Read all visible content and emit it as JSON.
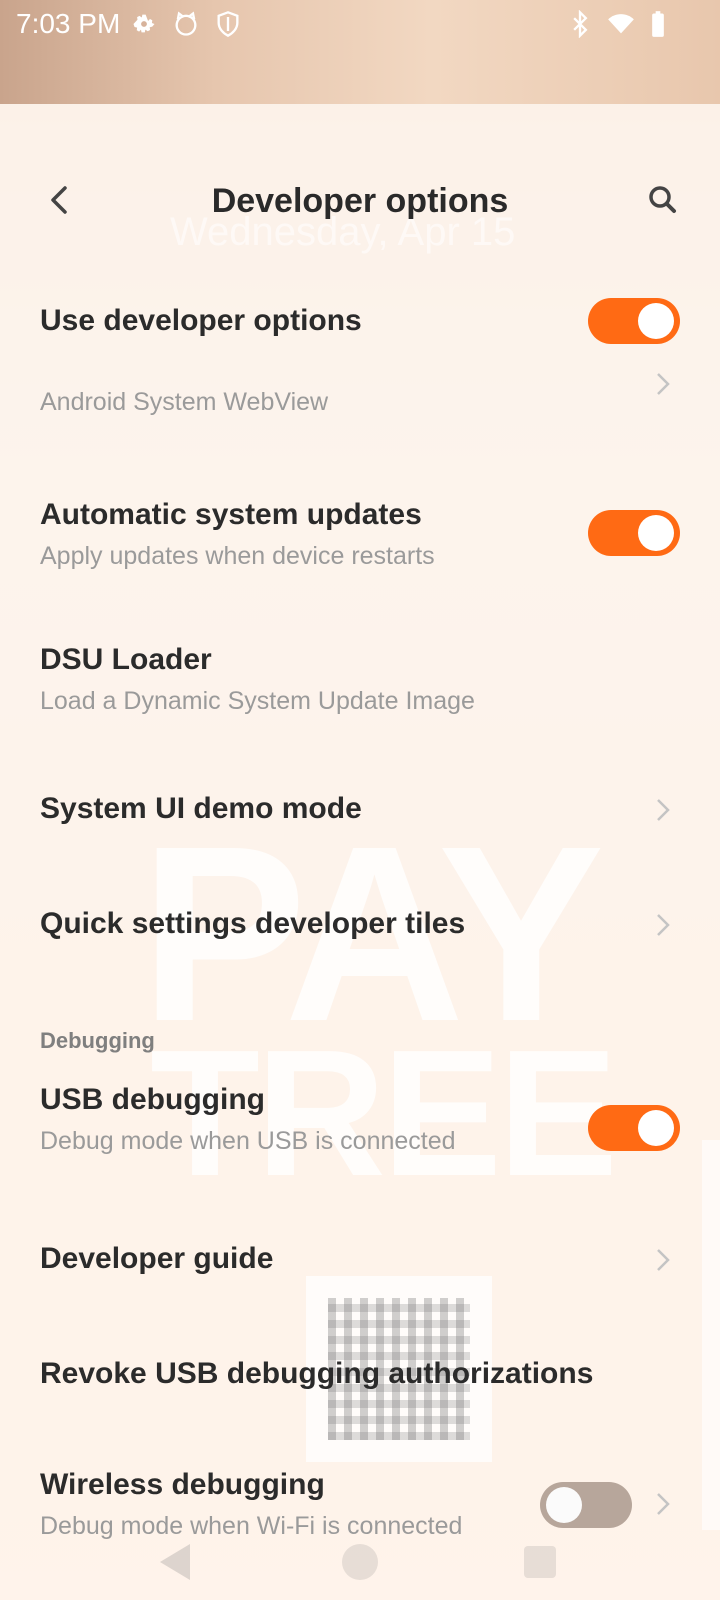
{
  "status_bar": {
    "time": "7:03 PM",
    "icons": [
      "gear-icon",
      "cat-face-icon",
      "shield-icon",
      "bluetooth-icon",
      "wifi-icon",
      "battery-icon"
    ]
  },
  "header": {
    "title": "Developer options",
    "back_icon": "chevron-left-icon",
    "search_icon": "search-icon"
  },
  "background": {
    "clock_text": "Wednesday, Apr 15",
    "wallpaper_line1": "PAY",
    "wallpaper_line2": "TREE"
  },
  "colors": {
    "accent": "#ff6a14",
    "toggle_off": "#b7a69b"
  },
  "settings": {
    "use_dev_options": {
      "title": "Use developer options",
      "enabled": true
    },
    "webview": {
      "subtitle": "Android System WebView"
    },
    "auto_updates": {
      "title": "Automatic system updates",
      "subtitle": "Apply updates when device restarts",
      "enabled": true
    },
    "dsu_loader": {
      "title": "DSU Loader",
      "subtitle": "Load a Dynamic System Update Image"
    },
    "demo_mode": {
      "title": "System UI demo mode"
    },
    "qs_tiles": {
      "title": "Quick settings developer tiles"
    },
    "debugging_header": "Debugging",
    "usb_debugging": {
      "title": "USB debugging",
      "subtitle": "Debug mode when USB is connected",
      "enabled": true
    },
    "developer_guide": {
      "title": "Developer guide"
    },
    "revoke_usb": {
      "title": "Revoke USB debugging authorizations"
    },
    "wireless_debugging": {
      "title": "Wireless debugging",
      "subtitle": "Debug mode when Wi-Fi is connected",
      "enabled": false
    }
  }
}
